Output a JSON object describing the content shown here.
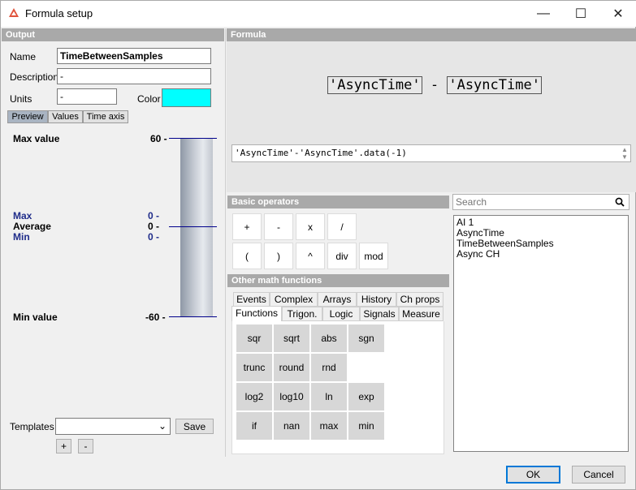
{
  "window": {
    "title": "Formula setup",
    "controls": {
      "minimize": "—",
      "maximize": "☐",
      "close": "✕"
    }
  },
  "output": {
    "header": "Output",
    "name_label": "Name",
    "name_value": "TimeBetweenSamples",
    "description_label": "Description",
    "description_value": "-",
    "units_label": "Units",
    "units_value": "-",
    "color_label": "Color",
    "color_value": "#00ffff",
    "tabs": [
      "Preview",
      "Values",
      "Time axis"
    ],
    "preview": {
      "max_value_label": "Max value",
      "max_value": "60 -",
      "max_label": "Max",
      "max_val": "0 -",
      "average_label": "Average",
      "average_val": "0 -",
      "min_label": "Min",
      "min_val": "0 -",
      "min_value_label": "Min value",
      "min_value": "-60 -"
    },
    "templates_label": "Templates",
    "save_label": "Save",
    "add_label": "+",
    "remove_label": "-"
  },
  "formula": {
    "header": "Formula",
    "display_left": "'AsyncTime'",
    "display_op": "-",
    "display_right": "'AsyncTime'",
    "expression": "'AsyncTime'-'AsyncTime'.data(-1)"
  },
  "basic_operators": {
    "header": "Basic operators",
    "row1": [
      "+",
      "-",
      "x",
      "/"
    ],
    "row2": [
      "(",
      ")",
      "^",
      "div",
      "mod"
    ]
  },
  "other_math": {
    "header": "Other math functions",
    "tabs_row1": [
      "Events",
      "Complex",
      "Arrays",
      "History",
      "Ch props"
    ],
    "tabs_row2": [
      "Functions",
      "Trigon.",
      "Logic",
      "Signals",
      "Measure"
    ],
    "functions": [
      [
        "sqr",
        "sqrt",
        "abs",
        "sgn"
      ],
      [
        "trunc",
        "round",
        "rnd"
      ],
      [
        "log2",
        "log10",
        "ln",
        "exp"
      ],
      [
        "if",
        "nan",
        "max",
        "min"
      ]
    ]
  },
  "channels": {
    "search_placeholder": "Search",
    "items": [
      "AI 1",
      "AsyncTime",
      "TimeBetweenSamples",
      "Async CH"
    ]
  },
  "footer": {
    "ok_label": "OK",
    "cancel_label": "Cancel"
  }
}
